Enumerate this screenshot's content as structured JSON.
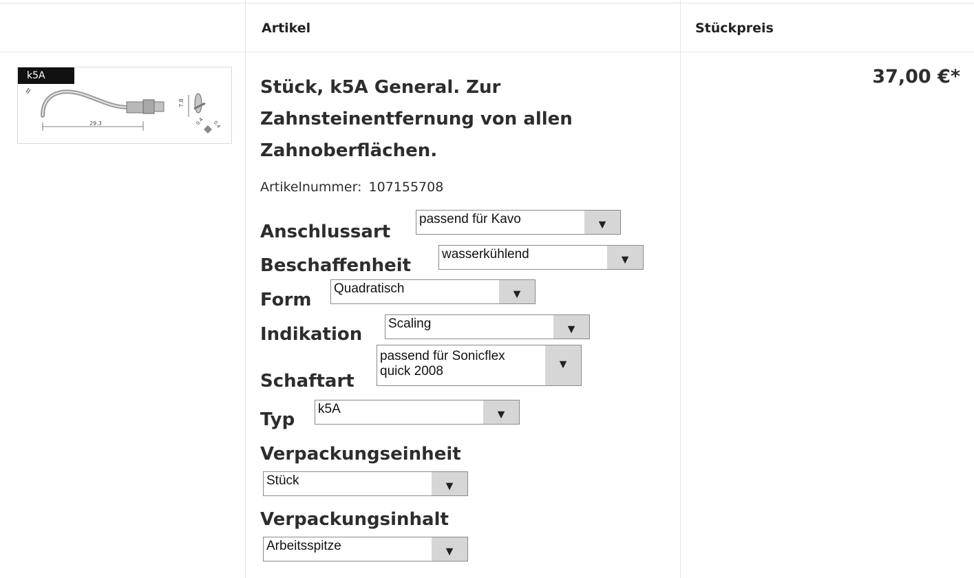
{
  "header": {
    "col_article": "Artikel",
    "col_price": "Stückpreis"
  },
  "product": {
    "thumb_tag": "k5A",
    "thumb_dim_length": "29.3",
    "thumb_dim_height": "7.8",
    "thumb_dim_a": "0.4",
    "thumb_dim_b": "0.4",
    "title": "Stück, k5A General. Zur Zahnsteinentfernung von allen Zahnoberflächen.",
    "artnr_label": "Artikelnummer:",
    "artnr_value": "107155708",
    "price": "37,00 €*"
  },
  "options": [
    {
      "label": "Anschlussart",
      "value": "passend für Kavo"
    },
    {
      "label": "Beschaffenheit",
      "value": "wasserkühlend"
    },
    {
      "label": "Form",
      "value": "Quadratisch"
    },
    {
      "label": "Indikation",
      "value": "Scaling"
    },
    {
      "label": "Schaftart",
      "value_line1": "passend für Sonicflex",
      "value_line2": "quick 2008"
    },
    {
      "label": "Typ",
      "value": "k5A"
    },
    {
      "label": "Verpackungseinheit",
      "value": "Stück"
    },
    {
      "label": "Verpackungsinhalt",
      "value": "Arbeitsspitze"
    }
  ],
  "icons": {
    "dropdown_arrow": "triangle-down-icon"
  }
}
